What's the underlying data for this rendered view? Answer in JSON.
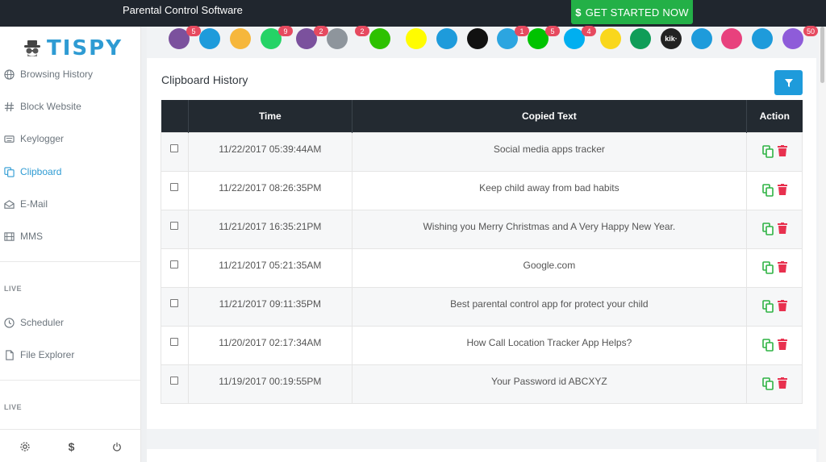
{
  "topbar": {
    "title": "Parental Control Software",
    "cta_label": "GET STARTED NOW",
    "cta_symbol": "$"
  },
  "logo": {
    "text": "TISPY"
  },
  "sidebar": {
    "items": [
      {
        "label": "Browsing History",
        "icon": "globe-icon"
      },
      {
        "label": "Block Website",
        "icon": "hash-icon"
      },
      {
        "label": "Keylogger",
        "icon": "keyboard-icon"
      },
      {
        "label": "Clipboard",
        "icon": "clipboard-icon",
        "active": true
      },
      {
        "label": "E-Mail",
        "icon": "envelope-open-icon"
      },
      {
        "label": "MMS",
        "icon": "film-icon"
      }
    ],
    "section1": "LIVE",
    "live_items": [
      {
        "label": "Scheduler",
        "icon": "clock-icon"
      },
      {
        "label": "File Explorer",
        "icon": "file-icon"
      }
    ],
    "section2": "LIVE",
    "bottom": {
      "dollar": "$"
    }
  },
  "apps": [
    {
      "icon": "viber-icon",
      "color": "#7b519d",
      "badge": "5"
    },
    {
      "icon": "mail-icon",
      "color": "#1e9bdb",
      "badge": ""
    },
    {
      "icon": "copy-app-icon",
      "color": "#f6b73c",
      "badge": ""
    },
    {
      "icon": "whatsapp-icon",
      "color": "#25d366",
      "badge": "9"
    },
    {
      "icon": "viber-alt-icon",
      "color": "#7b519d",
      "badge": "2"
    },
    {
      "icon": "clipboard-app-icon",
      "color": "#8e959c",
      "badge": ""
    },
    {
      "icon": "wechat-icon",
      "color": "#2dc100",
      "badge": "2"
    },
    {
      "icon": "phone-icon",
      "color": "#e64a5f",
      "badge": "9"
    },
    {
      "icon": "snapchat-icon",
      "color": "#fffc00",
      "badge": ""
    },
    {
      "icon": "flickr-icon",
      "color": "#1e9bdb",
      "badge": ""
    },
    {
      "icon": "tiktok-icon",
      "color": "#111111",
      "badge": ""
    },
    {
      "icon": "telegram-icon",
      "color": "#2ca5e0",
      "badge": "1"
    },
    {
      "icon": "line-icon",
      "color": "#00c300",
      "badge": "5"
    },
    {
      "icon": "skype-icon",
      "color": "#00aff0",
      "badge": "4"
    },
    {
      "icon": "kakao-icon",
      "color": "#f9d71c",
      "badge": ""
    },
    {
      "icon": "hangouts-icon",
      "color": "#0f9d58",
      "badge": ""
    },
    {
      "icon": "kik-icon",
      "color": "#222222",
      "badge": "",
      "text": "kik·"
    },
    {
      "icon": "badoo-icon",
      "color": "#1e9bdb",
      "badge": ""
    },
    {
      "icon": "video-icon",
      "color": "#e8417d",
      "badge": ""
    },
    {
      "icon": "hike-icon",
      "color": "#1e9bdb",
      "badge": ""
    },
    {
      "icon": "chat-icon",
      "color": "#8e5cd9",
      "badge": "50"
    }
  ],
  "main": {
    "title": "Clipboard History",
    "columns": [
      "Time",
      "Copied Text",
      "Action"
    ],
    "rows": [
      {
        "time": "11/22/2017 05:39:44AM",
        "text": "Social media apps tracker"
      },
      {
        "time": "11/22/2017 08:26:35PM",
        "text": "Keep child away from bad habits"
      },
      {
        "time": "11/21/2017 16:35:21PM",
        "text": "Wishing you Merry Christmas and A Very Happy New Year."
      },
      {
        "time": "11/21/2017 05:21:35AM",
        "text": "Google.com"
      },
      {
        "time": "11/21/2017 09:11:35PM",
        "text": "Best parental control app for protect your child"
      },
      {
        "time": "11/20/2017 02:17:34AM",
        "text": "How Call Location Tracker App Helps?"
      },
      {
        "time": "11/19/2017 00:19:55PM",
        "text": "Your Password id ABCXYZ"
      }
    ]
  },
  "colors": {
    "accent": "#1e9bdb",
    "topbar": "#20262e",
    "cta": "#23b047",
    "copy": "#2fb344",
    "delete": "#e8314f"
  }
}
